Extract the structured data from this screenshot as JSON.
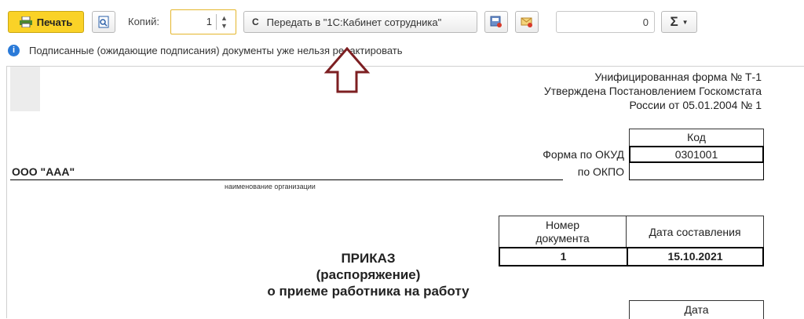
{
  "toolbar": {
    "print_label": "Печать",
    "copies_label": "Копий:",
    "copies_value": "1",
    "send_button_label": "Передать в \"1С:Кабинет сотрудника\"",
    "counter_value": "0",
    "sum_label": "Σ"
  },
  "info": {
    "text": "Подписанные (ожидающие подписания) документы уже нельзя редактировать"
  },
  "document": {
    "form_header": [
      "Унифицированная форма № Т-1",
      "Утверждена Постановлением Госкомстата",
      "России от 05.01.2004 № 1"
    ],
    "code_header": "Код",
    "okud_label": "Форма по ОКУД",
    "okud_value": "0301001",
    "okpo_label": "по ОКПО",
    "okpo_value": "",
    "org_name": "ООО \"ААА\"",
    "org_caption": "наименование организации",
    "doc_number_header_1": "Номер",
    "doc_number_header_2": "документа",
    "doc_date_header": "Дата составления",
    "doc_number": "1",
    "doc_date": "15.10.2021",
    "title_1": "ПРИКАЗ",
    "title_2": "(распоряжение)",
    "title_3": "о приеме работника на работу",
    "date_header": "Дата"
  }
}
